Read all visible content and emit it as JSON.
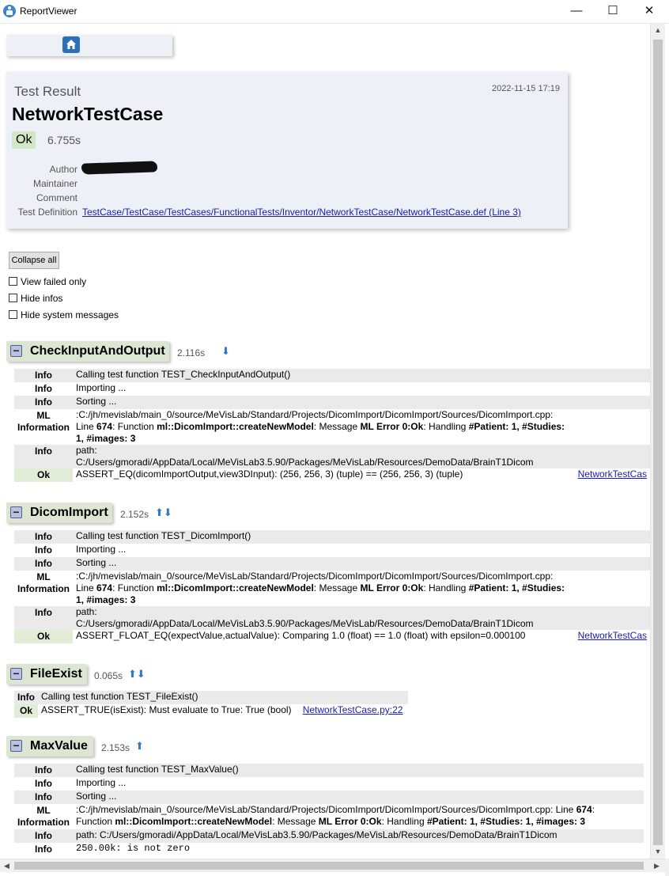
{
  "window": {
    "title": "ReportViewer",
    "minimize_glyph": "—",
    "maximize_glyph": "☐",
    "close_glyph": "✕"
  },
  "icons": {
    "app": "app-icon",
    "home": "home-icon",
    "collapse": "minus-icon",
    "arrow_up": "arrow-up-icon",
    "arrow_down": "arrow-down-icon"
  },
  "colors": {
    "ok_bg": "#d2e7c6",
    "section_bg": "#dde6d3",
    "link": "#1a1ab5",
    "arrow": "#2f78c8"
  },
  "result": {
    "label": "Test Result",
    "date": "2022-11-15 17:19",
    "title": "NetworkTestCase",
    "status": "Ok",
    "duration": "6.755s",
    "meta": {
      "author_label": "Author",
      "maintainer_label": "Maintainer",
      "comment_label": "Comment",
      "definition_label": "Test Definition",
      "definition_link": "TestCase/TestCase/TestCases/FunctionalTests/Inventor/NetworkTestCase/NetworkTestCase.def (Line 3)"
    }
  },
  "controls": {
    "collapse_all": "Collapse all",
    "view_failed_only": "View failed only",
    "hide_infos": "Hide infos",
    "hide_system_messages": "Hide system messages"
  },
  "sections": [
    {
      "name": "CheckInputAndOutput",
      "duration": "2.116s",
      "toggle": "−",
      "arrows": "⬇",
      "rows": [
        {
          "level": "Info",
          "message": "Calling test function TEST_CheckInputAndOutput()"
        },
        {
          "level": "Info",
          "message": "Importing ..."
        },
        {
          "level": "Info",
          "message": "Sorting ..."
        },
        {
          "level": "ML Information",
          "message_l1": ":C:/jh/mevislab/main_0/source/MeVisLab/Standard/Projects/DicomImport/DicomImport/Sources/DicomImport.cpp:",
          "message_l2a": "Line ",
          "line": "674",
          "message_l2b": ": Function ",
          "func": "ml::DicomImport::createNewModel",
          "message_l2c": ": Message ",
          "err": "ML Error 0:Ok",
          "message_l2d": ": Handling ",
          "tail1": "#Patient: 1, #Studies:",
          "tail2": "1, #images: 3"
        },
        {
          "level": "Info",
          "message_l1": "path:",
          "message_l2": "C:/Users/gmoradi/AppData/Local/MeVisLab3.5.90/Packages/MeVisLab/Resources/DemoData/BrainT1Dicom"
        },
        {
          "level": "Ok",
          "message": "ASSERT_EQ(dicomImportOutput,view3DInput): (256, 256, 3) (tuple) == (256, 256, 3) (tuple)",
          "link": "NetworkTestCas"
        }
      ]
    },
    {
      "name": "DicomImport",
      "duration": "2.152s",
      "toggle": "−",
      "arrows": "⬆⬇",
      "rows": [
        {
          "level": "Info",
          "message": "Calling test function TEST_DicomImport()"
        },
        {
          "level": "Info",
          "message": "Importing ..."
        },
        {
          "level": "Info",
          "message": "Sorting ..."
        },
        {
          "level": "ML Information",
          "message_l1": ":C:/jh/mevislab/main_0/source/MeVisLab/Standard/Projects/DicomImport/DicomImport/Sources/DicomImport.cpp:",
          "message_l2a": "Line ",
          "line": "674",
          "message_l2b": ": Function ",
          "func": "ml::DicomImport::createNewModel",
          "message_l2c": ": Message ",
          "err": "ML Error 0:Ok",
          "message_l2d": ": Handling ",
          "tail1": "#Patient: 1, #Studies:",
          "tail2": "1, #images: 3"
        },
        {
          "level": "Info",
          "message_l1": "path:",
          "message_l2": "C:/Users/gmoradi/AppData/Local/MeVisLab3.5.90/Packages/MeVisLab/Resources/DemoData/BrainT1Dicom"
        },
        {
          "level": "Ok",
          "message": "ASSERT_FLOAT_EQ(expectValue,actualValue): Comparing 1.0 (float) == 1.0 (float) with epsilon=0.000100",
          "link": "NetworkTestCas"
        }
      ]
    },
    {
      "name": "FileExist",
      "duration": "0.065s",
      "toggle": "−",
      "arrows": "⬆⬇",
      "rows": [
        {
          "level": "Info",
          "message": "Calling test function TEST_FileExist()"
        },
        {
          "level": "Ok",
          "message": "ASSERT_TRUE(isExist): Must evaluate to True: True (bool)",
          "link": "NetworkTestCase.py:22"
        }
      ]
    },
    {
      "name": "MaxValue",
      "duration": "2.153s",
      "toggle": "−",
      "arrows": "⬆",
      "rows": [
        {
          "level": "Info",
          "message": "Calling test function TEST_MaxValue()"
        },
        {
          "level": "Info",
          "message": "Importing ..."
        },
        {
          "level": "Info",
          "message": "Sorting ..."
        },
        {
          "level": "ML Information",
          "message_l1a": ":C:/jh/mevislab/main_0/source/MeVisLab/Standard/Projects/DicomImport/DicomImport/Sources/DicomImport.cpp: Line ",
          "line": "674",
          "message_l1b": ":",
          "message_l2a": "Function ",
          "func": "ml::DicomImport::createNewModel",
          "message_l2c": ": Message ",
          "err": "ML Error 0:Ok",
          "message_l2d": ": Handling ",
          "tail1": "#Patient: 1, #Studies: 1, #images: 3"
        },
        {
          "level": "Info",
          "message": "path: C:/Users/gmoradi/AppData/Local/MeVisLab3.5.90/Packages/MeVisLab/Resources/DemoData/BrainT1Dicom"
        },
        {
          "level": "Info",
          "message": "250.00k: is not zero"
        }
      ]
    }
  ],
  "scroll": {
    "up": "▲",
    "down": "▼",
    "left": "◀",
    "right": "▶"
  }
}
